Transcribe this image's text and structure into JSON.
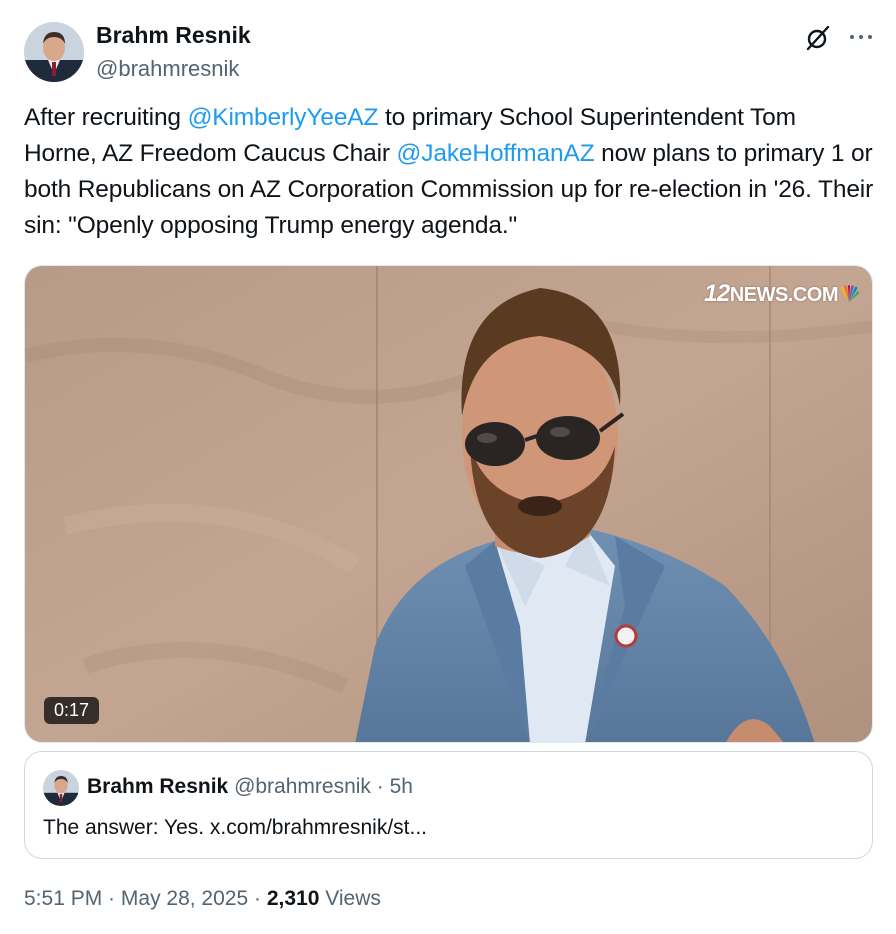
{
  "author": {
    "name": "Brahm Resnik",
    "handle": "@brahmresnik"
  },
  "tweet": {
    "segments": [
      {
        "text": "After recruiting ",
        "type": "text"
      },
      {
        "text": "@KimberlyYeeAZ",
        "type": "mention"
      },
      {
        "text": " to primary School Superintendent Tom Horne, AZ Freedom Caucus Chair ",
        "type": "text"
      },
      {
        "text": "@JakeHoffmanAZ",
        "type": "mention"
      },
      {
        "text": " now plans to primary 1 or both Republicans on AZ Corporation Commission up for re-election in '26. Their sin: \"Openly opposing Trump energy agenda.\"",
        "type": "text"
      }
    ]
  },
  "media": {
    "watermark_number": "12",
    "watermark_text": "NEWS.COM",
    "duration": "0:17"
  },
  "quote": {
    "name": "Brahm Resnik",
    "handle": "@brahmresnik",
    "dot": " · ",
    "time": "5h",
    "text": "The answer: Yes. x.com/brahmresnik/st..."
  },
  "footer": {
    "time": "5:51 PM",
    "sep1": " · ",
    "date": "May 28, 2025",
    "sep2": " · ",
    "views_count": "2,310",
    "views_label": " Views"
  },
  "icons": {
    "grok": "grok-icon",
    "more": "more-icon",
    "peacock": "peacock-icon"
  },
  "colors": {
    "mention": "#1d9bf0",
    "secondary_text": "#536471",
    "primary_text": "#0f1419"
  }
}
